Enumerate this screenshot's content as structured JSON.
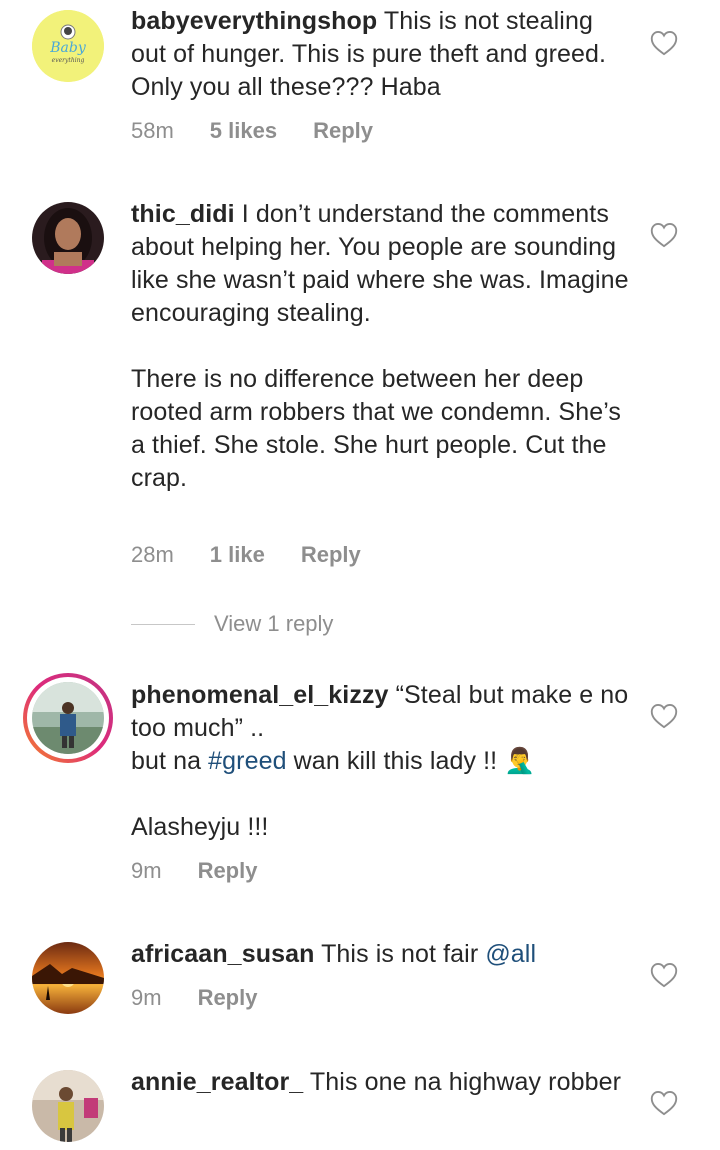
{
  "comments": [
    {
      "username": "babyeverythingshop",
      "text": "This is not stealing out of hunger. This is pure theft and greed. Only you all these??? Haba",
      "time": "58m",
      "likes": "5 likes",
      "reply": "Reply",
      "avatar_text": "Baby"
    },
    {
      "username": "thic_didi",
      "text": "I don’t understand the comments about helping her.  You people are sounding like she wasn’t paid where she was. Imagine encouraging stealing.",
      "text2": "There is no difference between her deep rooted arm robbers that we condemn. She’s a thief. She stole. She hurt people.  Cut the crap.",
      "time": "28m",
      "likes": "1 like",
      "reply": "Reply",
      "view_replies": "View 1 reply"
    },
    {
      "username": "phenomenal_el_kizzy",
      "text_a": "“Steal but make e no too much” ..",
      "text_b_before": "but na ",
      "hashtag": "#greed",
      "text_b_after": " wan kill this lady !! ",
      "emoji": "🤦‍♂️",
      "text_c": "Alasheyju !!!",
      "time": "9m",
      "reply": "Reply"
    },
    {
      "username": "africaan_susan",
      "text": "This is not fair ",
      "mention": "@all",
      "time": "9m",
      "reply": "Reply"
    },
    {
      "username": "annie_realtor_",
      "text": "This one na highway robber"
    }
  ],
  "icons": {
    "heart": "heart-outline-icon"
  },
  "colors": {
    "text": "#262626",
    "meta": "#8e8e8e",
    "link": "#1f4f7a",
    "story_ring_start": "#f58529",
    "story_ring_end": "#c13584"
  }
}
